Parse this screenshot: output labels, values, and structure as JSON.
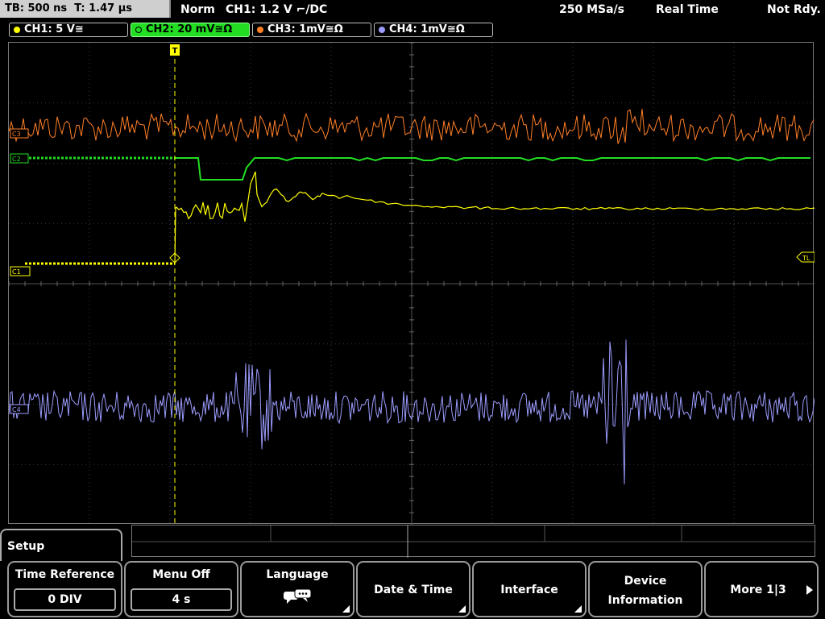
{
  "status": {
    "timebase": "TB: 500 ns",
    "trigger_time": "T: 1.47 µs",
    "trigger_mode": "Norm",
    "trigger_source": "CH1: 1.2 V ⌐/DC",
    "sample_rate": "250 MSa/s",
    "acq_mode": "Real Time",
    "run_state": "Not Rdy."
  },
  "channels": [
    {
      "label": "CH1: 5 V≅",
      "color": "#ffff00"
    },
    {
      "label": "CH2: 20 mV≅Ω",
      "color": "#22dd22",
      "active": true
    },
    {
      "label": "CH3: 1mV≅Ω",
      "color": "#ff7f27"
    },
    {
      "label": "CH4: 1mV≅Ω",
      "color": "#9c9cff"
    }
  ],
  "markers": {
    "c1": "C1",
    "c2": "C2",
    "c3": "C3",
    "c4": "C4",
    "trigger_level": "TL",
    "trigger_pos": "T"
  },
  "menu": {
    "title": "Setup",
    "softkeys": [
      {
        "label": "Time Reference",
        "value": "0 DIV"
      },
      {
        "label": "Menu Off",
        "value": "4 s"
      },
      {
        "label": "Language",
        "icon": "speech-bubbles-icon"
      },
      {
        "label": "Date & Time"
      },
      {
        "label": "Interface"
      },
      {
        "label_line1": "Device",
        "label_line2": "Information"
      },
      {
        "label": "More 1|3",
        "icon": "arrow-right-icon"
      }
    ]
  }
}
